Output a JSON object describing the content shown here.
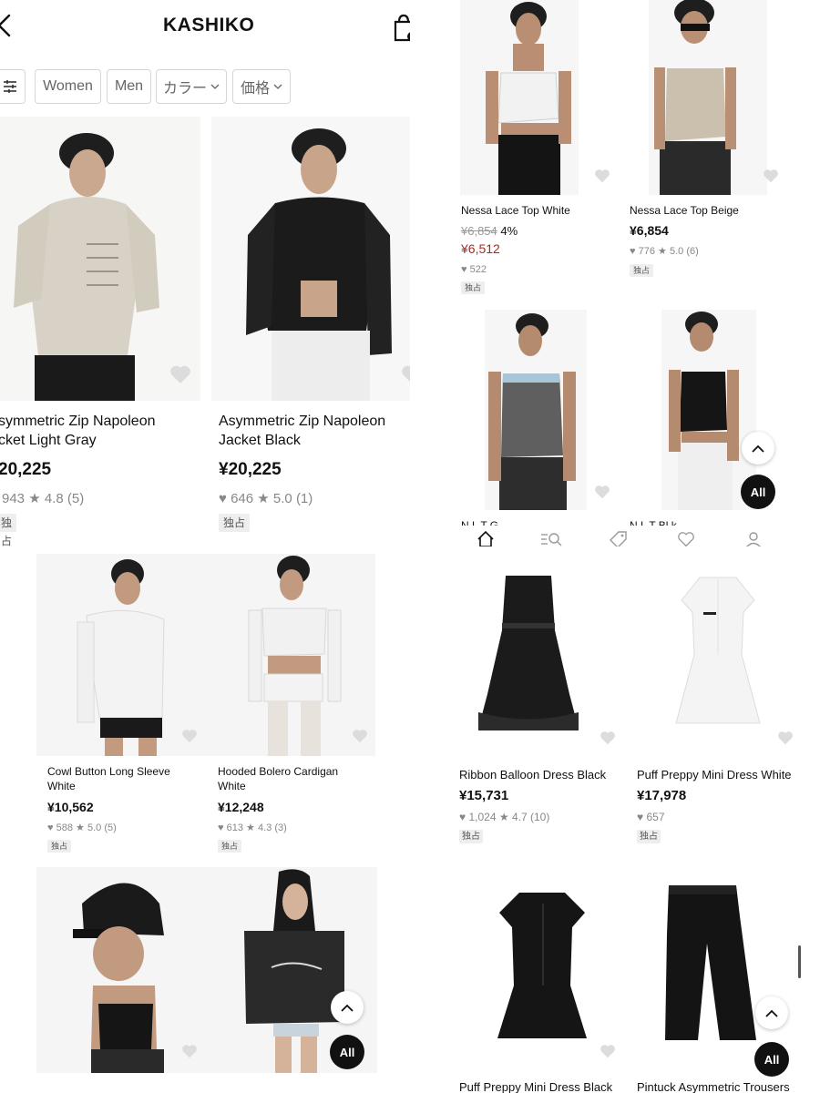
{
  "colors": {
    "sale": "#b3261e",
    "fab": "#111111",
    "muted": "#888888"
  },
  "header": {
    "title": "KASHIKO",
    "back_icon": "chevron-left-icon",
    "bag_icon": "shopping-bag-icon"
  },
  "filters": {
    "icon": "filter-sliders-icon",
    "chips": [
      "Women",
      "Men",
      "カラー",
      "価格"
    ]
  },
  "product_a1": {
    "name_line1": "symmetric Zip Napoleon",
    "name_line2": "cket Light Gray",
    "price": "20,225",
    "likes": "943",
    "rating": "4.8",
    "reviews": "(5)",
    "badge": "独占"
  },
  "product_a2": {
    "name_line1": "Asymmetric Zip Napoleon",
    "name_line2": "Jacket Black",
    "price": "¥20,225",
    "likes": "646",
    "rating": "5.0",
    "reviews": "(1)",
    "badge": "独占"
  },
  "product_b1": {
    "name": "Nessa Lace Top White",
    "original_price": "¥6,854",
    "discount": "4%",
    "sale_price": "¥6,512",
    "likes": "522",
    "badge": "独占"
  },
  "product_b2": {
    "name": "Nessa Lace Top Beige",
    "price": "¥6,854",
    "likes": "776",
    "rating": "5.0",
    "reviews": "(6)",
    "badge": "独占"
  },
  "product_b3": {
    "name_cut": "N       L   T  G"
  },
  "product_b4": {
    "name_cut": "N       L   T  Bl  k"
  },
  "bottom_nav": {
    "items": [
      "home-icon",
      "search-category-icon",
      "tag-icon",
      "heart-icon",
      "user-icon"
    ]
  },
  "product_c1": {
    "name_line1": "Cowl Button Long Sleeve",
    "name_line2": "White",
    "price": "¥10,562",
    "likes": "588",
    "rating": "5.0",
    "reviews": "(5)",
    "badge": "独占"
  },
  "product_c2": {
    "name_line1": "Hooded Bolero Cardigan",
    "name_line2": "White",
    "price": "¥12,248",
    "likes": "613",
    "rating": "4.3",
    "reviews": "(3)",
    "badge": "独占"
  },
  "product_d1": {
    "name": "Ribbon Balloon Dress Black",
    "price": "¥15,731",
    "likes": "1,024",
    "rating": "4.7",
    "reviews": "(10)",
    "badge": "独占"
  },
  "product_d2": {
    "name": "Puff Preppy Mini Dress White",
    "price": "¥17,978",
    "likes": "657",
    "badge": "独占"
  },
  "product_d3": {
    "name": "Puff Preppy Mini Dress Black"
  },
  "product_d4": {
    "name": "Pintuck Asymmetric Trousers"
  },
  "fab": {
    "all_label": "All"
  }
}
